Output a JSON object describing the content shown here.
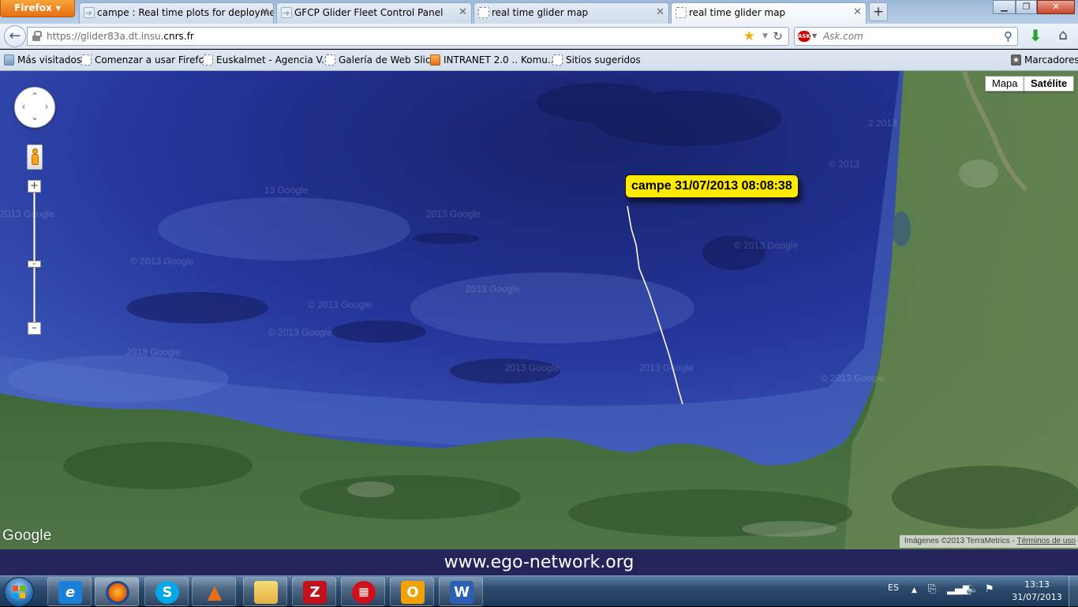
{
  "browser": {
    "menu_button": "Firefox",
    "tabs": [
      {
        "label": "campe : Real time plots for deployme..."
      },
      {
        "label": "GFCP Glider Fleet Control Panel"
      },
      {
        "label": "real time glider map"
      },
      {
        "label": "real time glider map"
      }
    ],
    "url_prefix": "https://glider83a.dt.insu.",
    "url_domain": "cnrs.fr",
    "search_placeholder": "Ask.com",
    "bookmarks": [
      {
        "label": "Más visitados"
      },
      {
        "label": "Comenzar a usar Firefox"
      },
      {
        "label": "Euskalmet - Agencia V..."
      },
      {
        "label": "Galería de Web Slice"
      },
      {
        "label": "INTRANET 2.0 .. Komu..."
      },
      {
        "label": "Sitios sugeridos"
      }
    ],
    "bookmarks_menu": "Marcadores"
  },
  "map": {
    "type_buttons": {
      "map": "Mapa",
      "satellite": "Satélite"
    },
    "glider_label": "campe 31/07/2013 08:08:38",
    "logo": "Google",
    "attribution": "Imágenes ©2013 TerraMetrics",
    "terms": "Términos de uso",
    "watermark": "© 2013 Google",
    "colors": {
      "sea_deep": "#1f2f86",
      "sea_shelf": "#5a79cc",
      "land": "#3f6a3a",
      "track": "#fffbe0",
      "label": "#ffeb00"
    }
  },
  "banner": {
    "text": "www.ego-network.org"
  },
  "taskbar": {
    "apps": [
      "internet-explorer",
      "firefox",
      "skype",
      "matlab",
      "file-explorer",
      "filezilla",
      "network-app",
      "outlook",
      "word"
    ],
    "language": "ES",
    "time": "13:13",
    "date": "31/07/2013"
  }
}
